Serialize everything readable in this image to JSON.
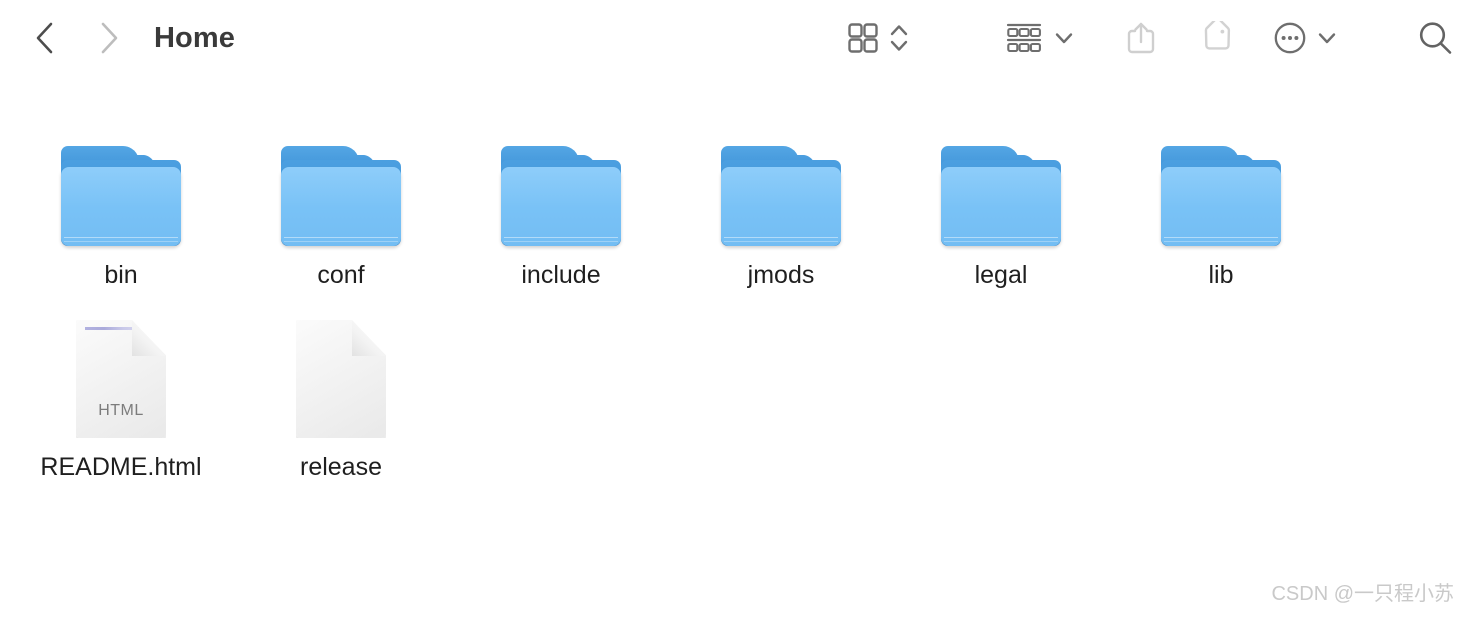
{
  "window": {
    "title": "Home"
  },
  "toolbar": {
    "back_button": {
      "name": "Back",
      "icon": "chevron-left-icon",
      "enabled": true,
      "color": "#4d4d4d"
    },
    "forward_button": {
      "name": "Forward",
      "icon": "chevron-right-icon",
      "enabled": false,
      "color": "#bdbdbd"
    },
    "view_mode_button": {
      "name": "Icon view",
      "icon": "grid-view-icon",
      "color": "#6e6e6e"
    },
    "view_mode_stepper": {
      "name": "View options",
      "icon": "chevron-up-down-icon",
      "color": "#6e6e6e"
    },
    "group_by_button": {
      "name": "Group items",
      "icon": "group-by-icon",
      "color": "#6e6e6e"
    },
    "group_by_chevron": {
      "name": "Group by menu",
      "icon": "chevron-down-icon",
      "color": "#6e6e6e"
    },
    "share_button": {
      "name": "Share",
      "icon": "share-icon",
      "enabled": false,
      "color": "#cfcfcf"
    },
    "tags_button": {
      "name": "Tags",
      "icon": "tag-icon",
      "enabled": false,
      "color": "#d2d2d2"
    },
    "more_button": {
      "name": "More",
      "icon": "ellipsis-circle-icon",
      "color": "#6e6e6e"
    },
    "more_chevron": {
      "name": "More menu",
      "icon": "chevron-down-icon",
      "color": "#6e6e6e"
    },
    "search_button": {
      "name": "Search",
      "icon": "search-icon",
      "color": "#636363"
    }
  },
  "files": [
    {
      "label": "bin",
      "kind": "folder"
    },
    {
      "label": "conf",
      "kind": "folder"
    },
    {
      "label": "include",
      "kind": "folder"
    },
    {
      "label": "jmods",
      "kind": "folder"
    },
    {
      "label": "legal",
      "kind": "folder"
    },
    {
      "label": "lib",
      "kind": "folder"
    },
    {
      "label": "README.html",
      "kind": "document",
      "badge": "HTML"
    },
    {
      "label": "release",
      "kind": "document",
      "badge": ""
    }
  ],
  "watermark": {
    "text": "CSDN @一只程小苏"
  },
  "colors": {
    "folder_tab": "#4a9fe0",
    "folder_body": "#7ec8f7",
    "background": "#ffffff",
    "label_text": "#1f1f1f",
    "title_text": "#3a3a3a"
  }
}
